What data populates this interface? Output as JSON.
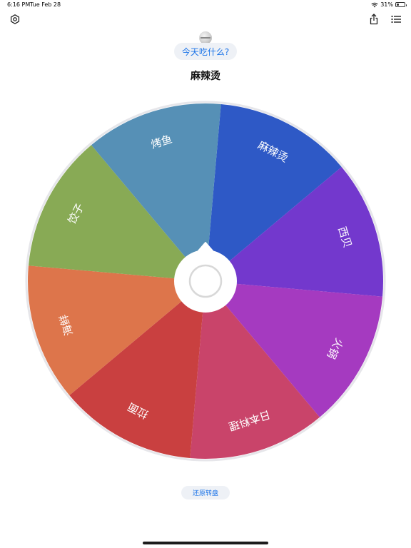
{
  "status": {
    "time": "6:16 PM",
    "date": "Tue Feb 28",
    "battery": "31%"
  },
  "header": {
    "question": "今天吃什么?",
    "result": "麻辣烫"
  },
  "wheel": {
    "segments": [
      {
        "label": "麻辣烫",
        "color": "#2e59c6"
      },
      {
        "label": "西贝",
        "color": "#7338cd"
      },
      {
        "label": "火锅",
        "color": "#a53ac0"
      },
      {
        "label": "日本料理",
        "color": "#c9446a"
      },
      {
        "label": "拉面",
        "color": "#c94040"
      },
      {
        "label": "海鲜",
        "color": "#dd754b"
      },
      {
        "label": "饺子",
        "color": "#88aa55"
      },
      {
        "label": "烤鱼",
        "color": "#5690b6"
      }
    ]
  },
  "footer": {
    "reset_label": "还原转盘"
  },
  "icons": {
    "settings": "settings-icon",
    "share": "share-icon",
    "list": "list-icon"
  }
}
